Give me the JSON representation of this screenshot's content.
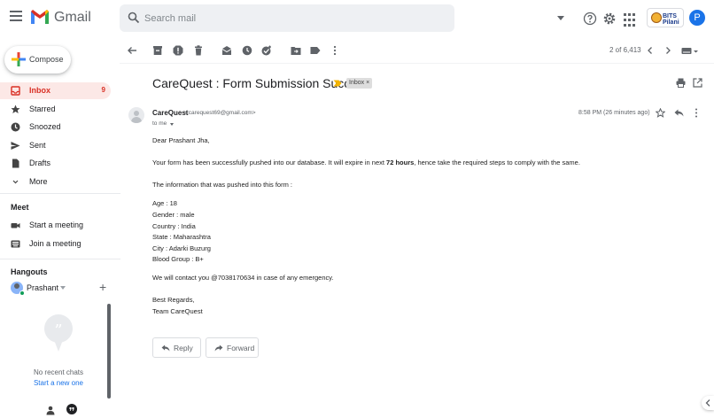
{
  "header": {
    "app_name": "Gmail",
    "search_placeholder": "Search mail",
    "org_badge_text": "BITS Pilani",
    "avatar_initial": "P"
  },
  "compose": {
    "label": "Compose"
  },
  "sidebar": {
    "items": [
      {
        "label": "Inbox",
        "count": "9",
        "icon": "inbox-icon",
        "active": true
      },
      {
        "label": "Starred",
        "icon": "star-icon"
      },
      {
        "label": "Snoozed",
        "icon": "clock-icon"
      },
      {
        "label": "Sent",
        "icon": "send-icon"
      },
      {
        "label": "Drafts",
        "icon": "draft-icon"
      },
      {
        "label": "More",
        "icon": "chevron-down-icon"
      }
    ],
    "meet": {
      "title": "Meet",
      "items": [
        {
          "label": "Start a meeting",
          "icon": "video-icon"
        },
        {
          "label": "Join a meeting",
          "icon": "keyboard-icon"
        }
      ]
    },
    "hangouts": {
      "title": "Hangouts",
      "user": "Prashant",
      "no_chats": "No recent chats",
      "start_new": "Start a new one"
    }
  },
  "toolbar": {
    "pagination": "2 of 6,413"
  },
  "email": {
    "subject": "CareQuest : Form Submission Success",
    "label_chip": "Inbox ×",
    "sender_name": "CareQuest",
    "sender_email": "<carequest69@gmail.com>",
    "to": "to me",
    "timestamp": "8:58 PM (26 minutes ago)",
    "greeting": "Dear Prashant Jha,",
    "para1_before": "Your form has been successfully pushed into our database. It will expire in next ",
    "para1_bold": "72 hours",
    "para1_after": ", hence take the required steps to comply with the same.",
    "intro": "The information that was pushed into this form :",
    "fields": [
      "Age : 18",
      "Gender : male",
      "Country : India",
      "State : Maharashtra",
      "City : Adarki Buzurg",
      "Blood Group : B+"
    ],
    "contact": "We will contact you @7038170634 in case of any emergency.",
    "signoff": "Best Regards,",
    "signature": "Team CareQuest"
  },
  "actions": {
    "reply": "Reply",
    "forward": "Forward"
  },
  "colors": {
    "gmail_red": "#d93025",
    "accent_blue": "#1a73e8",
    "active_bg": "#fce8e6",
    "importance_yellow": "#f4b400"
  }
}
